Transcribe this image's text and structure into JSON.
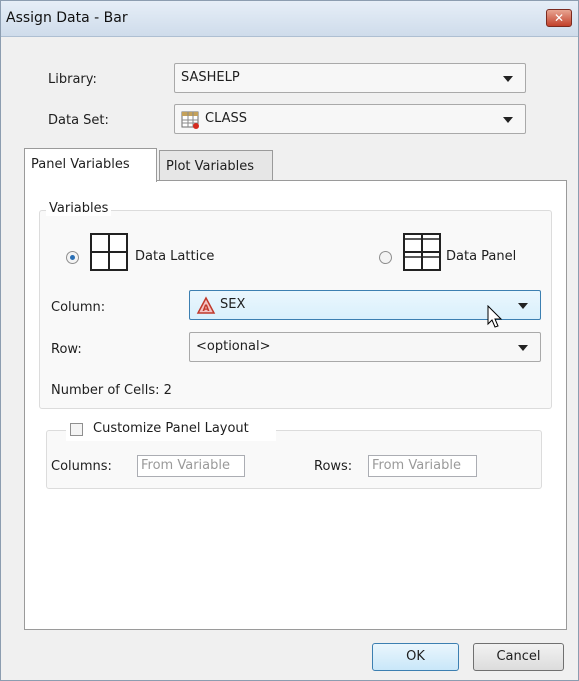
{
  "window": {
    "title": "Assign Data - Bar",
    "close_glyph": "✕"
  },
  "library": {
    "label": "Library:",
    "value": "SASHELP"
  },
  "data_set": {
    "label": "Data Set:",
    "value": "CLASS",
    "icon": "table-icon"
  },
  "tabs": [
    {
      "label": "Panel Variables",
      "active": true
    },
    {
      "label": "Plot Variables",
      "active": false
    }
  ],
  "variables": {
    "legend": "Variables",
    "option_lattice": {
      "label": "Data Lattice",
      "checked": true,
      "icon": "lattice-grid-icon"
    },
    "option_panel": {
      "label": "Data Panel",
      "checked": false,
      "icon": "panel-grid-icon"
    },
    "column": {
      "label": "Column:",
      "value": "SEX",
      "icon": "variable-a-icon"
    },
    "row": {
      "label": "Row:",
      "value": "<optional>"
    },
    "cells": "Number of Cells: 2"
  },
  "layout": {
    "checkbox_label": "Customize Panel Layout",
    "checked": false,
    "columns_label": "Columns:",
    "columns_placeholder": "From Variable",
    "rows_label": "Rows:",
    "rows_placeholder": "From Variable"
  },
  "buttons": {
    "ok": "OK",
    "cancel": "Cancel"
  },
  "colors": {
    "accent": "#3c7fb1",
    "titlebar": "#cfdceb",
    "close": "#c2402a"
  }
}
